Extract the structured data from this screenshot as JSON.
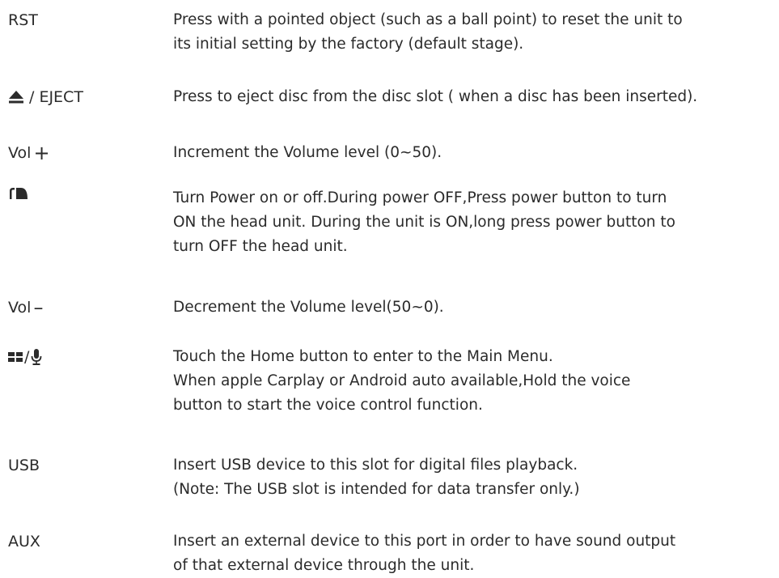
{
  "rows": [
    {
      "label": "RST",
      "lines": [
        "Press with a pointed object (such as a ball point) to reset the unit to",
        "its initial setting by the factory (default stage)."
      ]
    },
    {
      "label": "/ EJECT",
      "icon": "eject-icon",
      "lines": [
        "Press to eject disc from the disc slot ( when a disc has been inserted)."
      ]
    },
    {
      "label": "Vol",
      "suffix": "+",
      "lines": [
        "Increment the Volume level (0~50)."
      ]
    },
    {
      "icon": "power-icon",
      "lines": [
        "Turn Power on or off.During power OFF,Press power button to turn",
        "ON the head unit. During the unit is ON,long press power button to",
        "turn OFF the head unit."
      ]
    },
    {
      "label": "Vol",
      "suffix": "–",
      "lines": [
        "Decrement the Volume level(50~0)."
      ]
    },
    {
      "label": "/",
      "icon": "home-voice-icon",
      "lines": [
        "Touch the Home button to enter to the Main Menu.",
        "When apple Carplay or Android auto available,Hold the voice",
        "button to start the voice control function."
      ]
    },
    {
      "label": "USB",
      "lines": [
        "Insert USB device to this slot for digital files playback.",
        "(Note: The USB slot is intended for data transfer only.)"
      ]
    },
    {
      "label": "AUX",
      "lines": [
        "Insert an external device to this port in order to have sound output",
        "of that external device through the unit."
      ]
    }
  ]
}
